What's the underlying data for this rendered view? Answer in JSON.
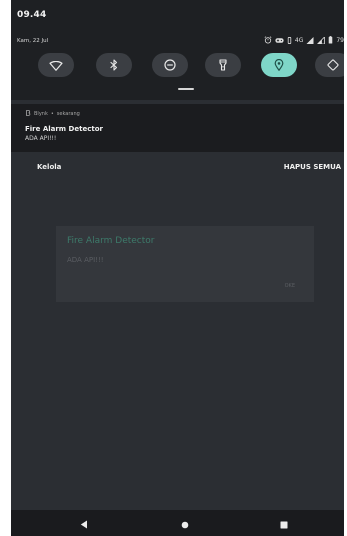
{
  "status_bar": {
    "time": "09.44",
    "date": "Kam, 22 Jul",
    "network": "4G",
    "battery": "79"
  },
  "quick_settings": [
    {
      "icon": "wifi-icon",
      "active": false
    },
    {
      "icon": "bluetooth-icon",
      "active": false
    },
    {
      "icon": "do-not-disturb-icon",
      "active": false
    },
    {
      "icon": "flashlight-icon",
      "active": false
    },
    {
      "icon": "location-icon",
      "active": true
    },
    {
      "icon": "auto-rotate-icon",
      "active": false
    }
  ],
  "notification": {
    "app": "Blynk",
    "separator": "•",
    "time": "sekarang",
    "title": "Fire Alarm Detector",
    "body": "ADA API!!!"
  },
  "actions": {
    "manage": "Kelola",
    "clear_all": "HAPUS SEMUA"
  },
  "dialog": {
    "title": "Fire Alarm Detector",
    "message": "ADA API!!!",
    "ok": "OKE"
  },
  "colors": {
    "accent": "#7fd6c8",
    "background": "#2b2e33",
    "shade": "#1e2023"
  }
}
